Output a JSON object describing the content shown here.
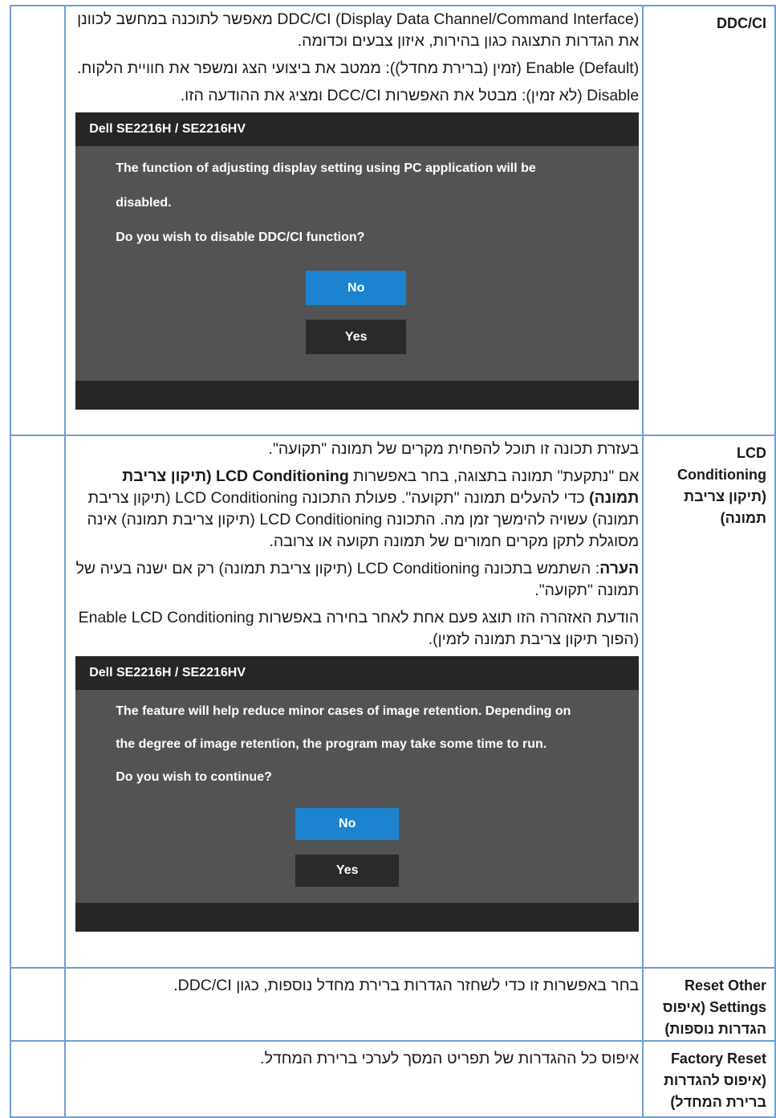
{
  "rows": {
    "ddc": {
      "label": "DDC/CI",
      "paragraphs": [
        "DDC/CI (Display Data Channel/Command Interface) מאפשר לתוכנה במחשב לכוונן את הגדרות התצוגה כגון בהירות, איזון צבעים וכדומה.",
        "Enable (Default) (זמין (ברירת מחדל)): ממטב את ביצועי הצג ומשפר את חוויית הלקוח.",
        "Disable (לא זמין): מבטל את האפשרות DCC/CI ומציג את ההודעה הזו."
      ],
      "dialog": {
        "title": "Dell SE2216H / SE2216HV",
        "lines": [
          "The function of adjusting display setting using PC application will be",
          "disabled.",
          "Do you wish to disable DDC/CI function?"
        ],
        "no_label": "No",
        "yes_label": "Yes"
      }
    },
    "lcd": {
      "label_lines": [
        "LCD",
        "Conditioning",
        "(תיקון צריבת",
        "תמונה)"
      ],
      "p1": "בעזרת תכונה זו תוכל להפחית מקרים של תמונה \"תקועה\".",
      "p2_a": "אם \"נתקעת\" תמונה בתצוגה, בחר באפשרות ",
      "p2_b": "LCD Conditioning (תיקון צריבת תמונה)",
      "p2_c": " כדי להעלים תמונה \"תקועה\". פעולת התכונה LCD Conditioning (תיקון צריבת תמונה) עשויה להימשך זמן מה. התכונה LCD Conditioning (תיקון צריבת תמונה) אינה מסוגלת לתקן מקרים חמורים של תמונה תקועה או צרובה.",
      "p3_a": "הערה",
      "p3_b": ": השתמש בתכונה LCD Conditioning (תיקון צריבת תמונה) רק אם ישנה בעיה של תמונה \"תקועה\".",
      "p4": "הודעת האזהרה הזו תוצג פעם אחת לאחר בחירה באפשרות Enable LCD Conditioning (הפוך תיקון צריבת תמונה לזמין).",
      "dialog": {
        "title": "Dell SE2216H / SE2216HV",
        "lines": [
          "The feature will help reduce minor cases of image retention. Depending on",
          "the degree of image retention, the program may take some time to run.",
          "Do you wish to continue?"
        ],
        "no_label": "No",
        "yes_label": "Yes"
      }
    },
    "reset_other": {
      "label_lines": [
        "Reset Other",
        "Settings (איפוס",
        "הגדרות נוספות)"
      ],
      "text": "בחר באפשרות זו כדי לשחזר הגדרות ברירת מחדל נוספות, כגון DDC/CI."
    },
    "factory": {
      "label_lines": [
        "Factory Reset",
        "(איפוס להגדרות",
        "ברירת המחדל)"
      ],
      "text": "איפוס כל ההגדרות של תפריט המסך לערכי ברירת המחדל."
    }
  }
}
